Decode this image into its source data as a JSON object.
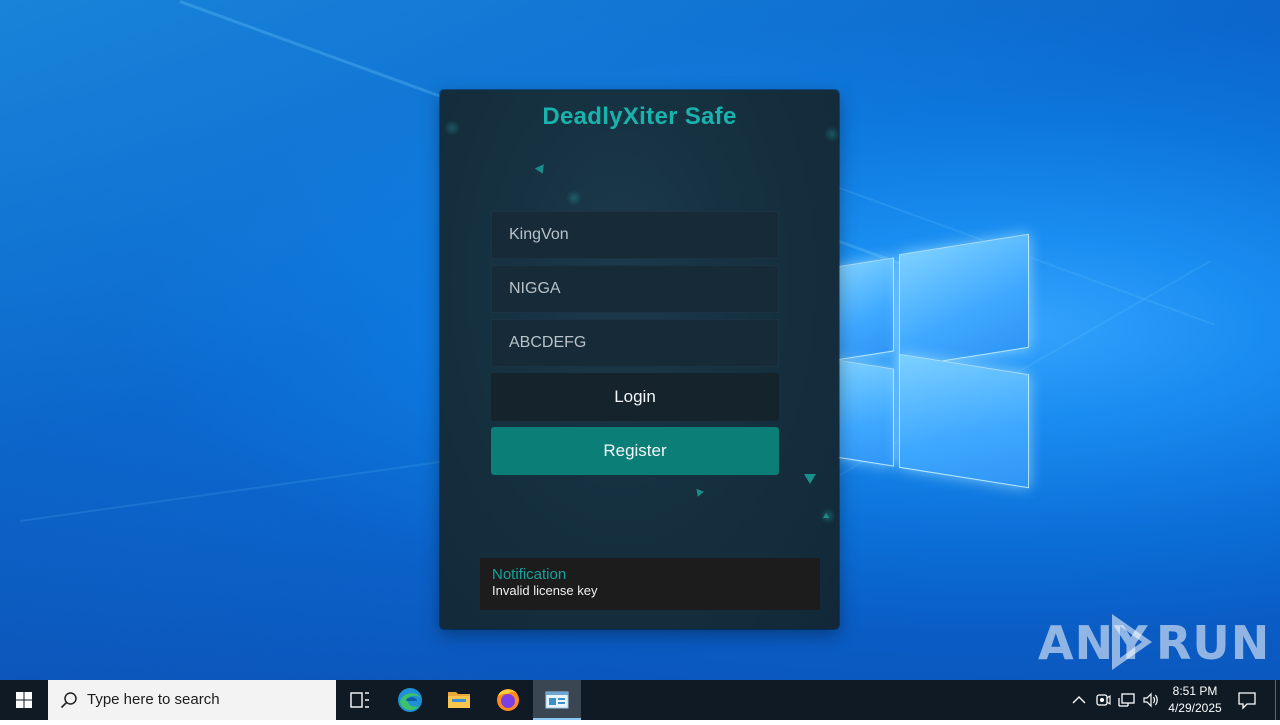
{
  "app": {
    "title": "DeadlyXiter Safe",
    "fields": {
      "username": "KingVon",
      "password": "NIGGA",
      "license_key": "ABCDEFG"
    },
    "buttons": {
      "login": "Login",
      "register": "Register"
    },
    "notification": {
      "title": "Notification",
      "message": "Invalid license key"
    },
    "colors": {
      "accent": "#19b3ad",
      "register_button": "#0b7e78",
      "background": "#15303f"
    }
  },
  "watermark": {
    "left": "ANY",
    "right": "RUN"
  },
  "taskbar": {
    "search_placeholder": "Type here to search",
    "pinned_icons": [
      "task-view-icon",
      "edge-icon",
      "file-explorer-icon",
      "firefox-icon",
      "active-app-icon"
    ],
    "tray_icons": [
      "chevron-up-icon",
      "meet-now-icon",
      "network-icon",
      "volume-icon"
    ],
    "time": "8:51 PM",
    "date": "4/29/2025"
  }
}
